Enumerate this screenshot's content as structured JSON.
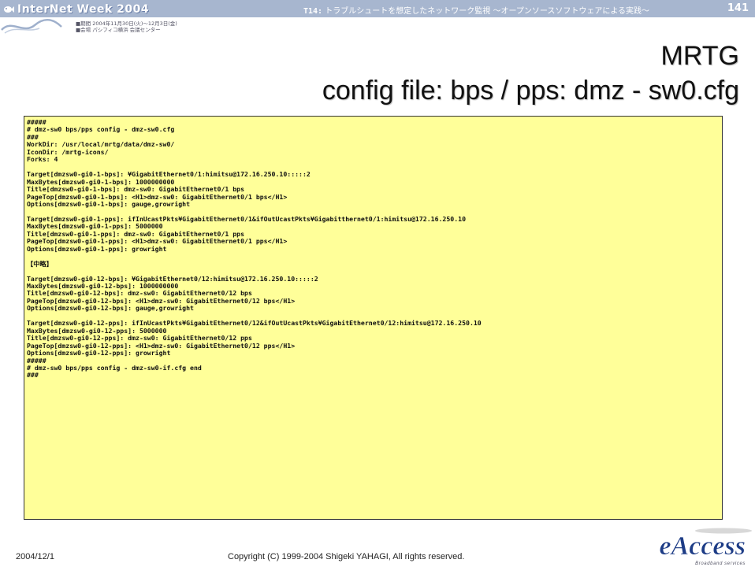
{
  "header": {
    "logo_text": "InterNet Week 2004",
    "session_code": "T14:",
    "session_title": "トラブルシュートを想定したネットワーク監視 ～オープンソースソフトウェアによる実践～",
    "page_number": "141",
    "info_line1": "■期間 2004年11月30日(火)～12月3日(金)",
    "info_line2": "■会場 パシフィコ横浜 会議センター"
  },
  "slide": {
    "title_line1": "MRTG",
    "title_line2": "config file: bps / pps: dmz - sw0.cfg"
  },
  "code": {
    "lines": [
      "#####",
      "# dmz-sw0 bps/pps config - dmz-sw0.cfg",
      "###",
      "WorkDir: /usr/local/mrtg/data/dmz-sw0/",
      "IconDir: /mrtg-icons/",
      "Forks: 4",
      "",
      "Target[dmzsw0-gi0-1-bps]: ¥GigabitEthernet0/1:himitsu@172.16.250.10:::::2",
      "MaxBytes[dmzsw0-gi0-1-bps]: 1000000000",
      "Title[dmzsw0-gi0-1-bps]: dmz-sw0: GigabitEthernet0/1 bps",
      "PageTop[dmzsw0-gi0-1-bps]: <H1>dmz-sw0: GigabitEthernet0/1 bps</H1>",
      "Options[dmzsw0-gi0-1-bps]: gauge,growright",
      "",
      "Target[dmzsw0-gi0-1-pps]: ifInUcastPkts¥GigabitEthernet0/1&ifOutUcastPkts¥Gigabitthernet0/1:himitsu@172.16.250.10",
      "MaxBytes[dmzsw0-gi0-1-pps]: 5000000",
      "Title[dmzsw0-gi0-1-pps]: dmz-sw0: GigabitEthernet0/1 pps",
      "PageTop[dmzsw0-gi0-1-pps]: <H1>dmz-sw0: GigabitEthernet0/1 pps</H1>",
      "Options[dmzsw0-gi0-1-pps]: growright",
      "",
      "【中略】",
      "",
      "Target[dmzsw0-gi0-12-bps]: ¥GigabitEthernet0/12:himitsu@172.16.250.10:::::2",
      "MaxBytes[dmzsw0-gi0-12-bps]: 1000000000",
      "Title[dmzsw0-gi0-12-bps]: dmz-sw0: GigabitEthernet0/12 bps",
      "PageTop[dmzsw0-gi0-12-bps]: <H1>dmz-sw0: GigabitEthernet0/12 bps</H1>",
      "Options[dmzsw0-gi0-12-bps]: gauge,growright",
      "",
      "Target[dmzsw0-gi0-12-pps]: ifInUcastPkts¥GigabitEthernet0/12&ifOutUcastPkts¥GigabitEthernet0/12:himitsu@172.16.250.10",
      "MaxBytes[dmzsw0-gi0-12-pps]: 5000000",
      "Title[dmzsw0-gi0-12-pps]: dmz-sw0: GigabitEthernet0/12 pps",
      "PageTop[dmzsw0-gi0-12-pps]: <H1>dmz-sw0: GigabitEthernet0/12 pps</H1>",
      "Options[dmzsw0-gi0-12-pps]: growright",
      "#####",
      "# dmz-sw0 bps/pps config - dmz-sw0-if.cfg end",
      "###"
    ]
  },
  "footer": {
    "date": "2004/12/1",
    "copyright": "Copyright (C) 1999-2004 Shigeki YAHAGI, All rights reserved.",
    "brand": "eAccess",
    "brand_tagline": "Broadband services"
  }
}
